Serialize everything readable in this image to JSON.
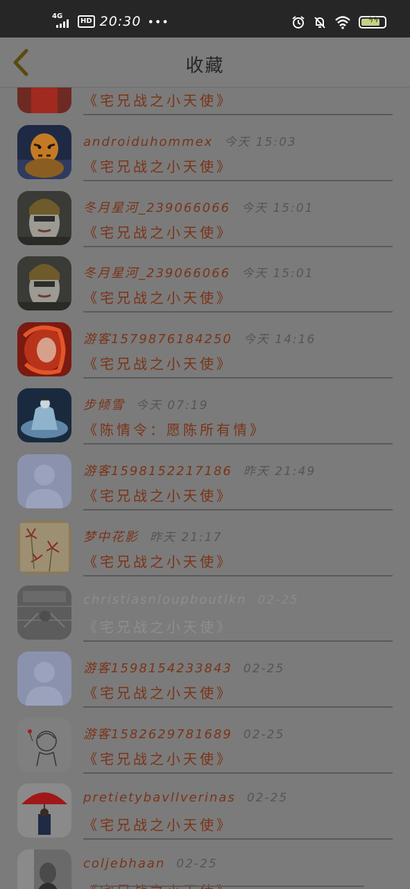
{
  "status_bar": {
    "network": "4G",
    "hd_badge": "HD",
    "time": "20:30",
    "more": "•••"
  },
  "header": {
    "title": "收藏"
  },
  "items": [
    {
      "name": "",
      "time": "",
      "work": "《宅兄战之小天使》",
      "avatar": "red-figure"
    },
    {
      "name": "androiduhommex",
      "time": "今天 15:03",
      "work": "《宅兄战之小天使》",
      "avatar": "tiger"
    },
    {
      "name": "冬月星河_239066066",
      "time": "今天 15:01",
      "work": "《宅兄战之小天使》",
      "avatar": "masked-warrior"
    },
    {
      "name": "冬月星河_239066066",
      "time": "今天 15:01",
      "work": "《宅兄战之小天使》",
      "avatar": "masked-warrior"
    },
    {
      "name": "游客1579876184250",
      "time": "今天 14:16",
      "work": "《宅兄战之小天使》",
      "avatar": "red-hair"
    },
    {
      "name": "步倾雪",
      "time": "今天 07:19",
      "work": "《陈情令：愿陈所有情》",
      "avatar": "ice-dress"
    },
    {
      "name": "游客1598152217186",
      "time": "昨天 21:49",
      "work": "《宅兄战之小天使》",
      "avatar": "default-user"
    },
    {
      "name": "梦中花影",
      "time": "昨天 21:17",
      "work": "《宅兄战之小天使》",
      "avatar": "red-flowers"
    },
    {
      "name": "christiasnloupboutlkn",
      "time": "02-25",
      "work": "《宅兄战之小天使》",
      "avatar": "grey-room",
      "faded": true
    },
    {
      "name": "游客1598154233843",
      "time": "02-25",
      "work": "《宅兄战之小天使》",
      "avatar": "default-user"
    },
    {
      "name": "游客1582629781689",
      "time": "02-25",
      "work": "《宅兄战之小天使》",
      "avatar": "sketch-girl"
    },
    {
      "name": "pretietybavllverinas",
      "time": "02-25",
      "work": "《宅兄战之小天使》",
      "avatar": "red-umbrella"
    },
    {
      "name": "coljebhaan",
      "time": "02-25",
      "work": "《宅兄战之小天使》",
      "avatar": "bw-portrait"
    }
  ]
}
